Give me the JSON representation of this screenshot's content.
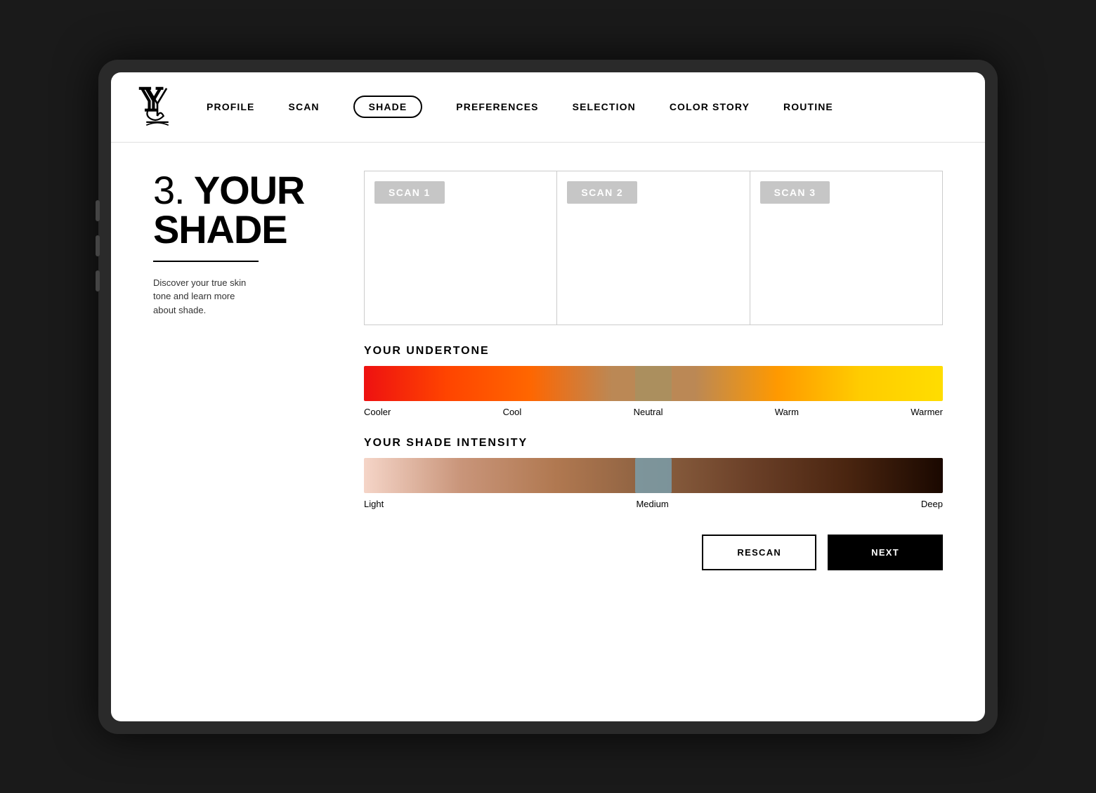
{
  "nav": {
    "items": [
      {
        "label": "PROFILE",
        "active": false
      },
      {
        "label": "SCAN",
        "active": false
      },
      {
        "label": "SHADE",
        "active": true
      },
      {
        "label": "PREFERENCES",
        "active": false
      },
      {
        "label": "SELECTION",
        "active": false
      },
      {
        "label": "COLOR STORY",
        "active": false
      },
      {
        "label": "ROUTINE",
        "active": false
      }
    ]
  },
  "page": {
    "step_number": "3.",
    "title_line1": "YOUR",
    "title_line2": "SHADE",
    "description": "Discover your true skin\ntone and learn more\nabout shade."
  },
  "scans": [
    {
      "label": "SCAN 1"
    },
    {
      "label": "SCAN 2"
    },
    {
      "label": "SCAN 3"
    }
  ],
  "undertone": {
    "section_title": "YOUR UNDERTONE",
    "labels": {
      "left": "Cooler",
      "center_left": "Cool",
      "center": "Neutral",
      "center_right": "Warm",
      "right": "Warmer"
    }
  },
  "intensity": {
    "section_title": "YOUR SHADE INTENSITY",
    "labels": {
      "left": "Light",
      "center": "Medium",
      "right": "Deep"
    }
  },
  "buttons": {
    "rescan": "RESCAN",
    "next": "NEXT"
  }
}
